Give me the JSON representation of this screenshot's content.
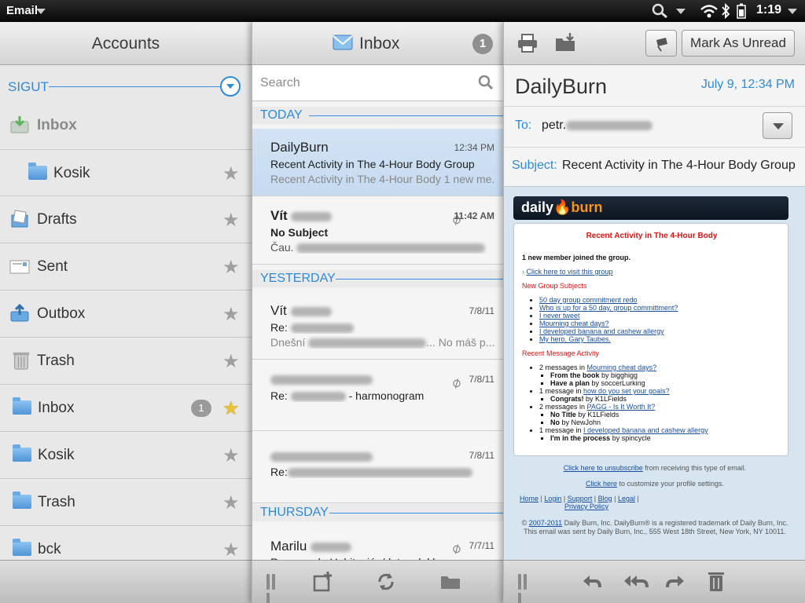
{
  "statusbar": {
    "app_name": "Email",
    "time": "1:19"
  },
  "accounts": {
    "title": "Accounts",
    "account_name": "SIGUT",
    "folders": [
      {
        "label": "Inbox",
        "icon": "inbox-icon",
        "muted": true
      },
      {
        "label": "Kosik",
        "icon": "folder-icon"
      },
      {
        "label": "Drafts",
        "icon": "drafts-icon"
      },
      {
        "label": "Sent",
        "icon": "sent-icon"
      },
      {
        "label": "Outbox",
        "icon": "outbox-icon"
      },
      {
        "label": "Trash",
        "icon": "trash-icon"
      },
      {
        "label": "Inbox",
        "icon": "folder-icon",
        "badge": "1",
        "favorite": true
      },
      {
        "label": "Kosik",
        "icon": "folder-icon"
      },
      {
        "label": "Trash",
        "icon": "folder-icon"
      },
      {
        "label": "bck",
        "icon": "folder-icon"
      }
    ]
  },
  "inbox": {
    "title": "Inbox",
    "unread_count": "1",
    "search_placeholder": "Search",
    "groups": {
      "today": "TODAY",
      "yesterday": "YESTERDAY",
      "thursday": "THURSDAY"
    },
    "messages": [
      {
        "from": "DailyBurn",
        "time": "12:34 PM",
        "subject": "Recent Activity in The 4-Hour Body Group",
        "preview": "Recent Activity in The 4-Hour Body 1 new me..."
      },
      {
        "from": "Vít",
        "time": "11:42 AM",
        "subject": "No Subject",
        "preview": "Čau."
      },
      {
        "from": "Vít",
        "time": "7/8/11",
        "subject": "Re:",
        "preview": "Dnešní",
        "preview_end": "... No máš p..."
      },
      {
        "from": "",
        "time": "7/8/11",
        "subject": "Re:",
        "subject_end": "- harmonogram",
        "preview": ""
      },
      {
        "from": "",
        "time": "7/8/11",
        "subject": "Re:",
        "preview": ""
      },
      {
        "from": "Marilu",
        "time": "7/7/11",
        "subject": "Reserva de Habitación/datos del h..."
      }
    ]
  },
  "message": {
    "mark_unread_label": "Mark As Unread",
    "sender": "DailyBurn",
    "date": "July 9, 12:34 PM",
    "to_label": "To:",
    "to_value": "petr.",
    "subject_label": "Subject:",
    "subject_value": "Recent Activity in The 4-Hour Body Group",
    "body": {
      "logo_a": "daily",
      "logo_b": "burn",
      "heading": "Recent Activity in The 4-Hour Body",
      "joined": "1 new member joined the group.",
      "visit_link": "Click here to visit this group",
      "new_subjects_title": "New Group Subjects",
      "new_subjects": [
        "50 day group commitment redo",
        "Who is up for a 50 day, group committment?",
        "I never tweet",
        "Mourning cheat days?",
        "I developed banana and cashew allergy",
        "My hero, Gary Taubes."
      ],
      "activity_title": "Recent Message Activity",
      "activity": [
        {
          "pre": "2 messages in",
          "link": "Mourning cheat days?",
          "items": [
            {
              "b": "From the book",
              "by": "by bigghigg"
            },
            {
              "b": "Have a plan",
              "by": "by soccerLurking"
            }
          ]
        },
        {
          "pre": "1 message in",
          "link": "how do you set your goals?",
          "items": [
            {
              "b": "Congrats!",
              "by": "by K1LFields"
            }
          ]
        },
        {
          "pre": "2 messages in",
          "link": "PAGG - Is It Worth It?",
          "items": [
            {
              "b": "No Title",
              "by": "by K1LFields"
            },
            {
              "b": "No",
              "by": "by NewJohn"
            }
          ]
        },
        {
          "pre": "1 message in",
          "link": "I developed banana and cashew allergy",
          "items": [
            {
              "b": "I'm in the process",
              "by": "by spincycle"
            }
          ]
        }
      ],
      "unsub_link": "Click here to unsubscribe",
      "unsub_rest": " from receiving this type of email.",
      "profile_link": "Click here",
      "profile_rest": " to customize your profile settings.",
      "footer_links": [
        "Home",
        "Login",
        "Support",
        "Blog",
        "Legal",
        "Privacy Policy"
      ],
      "copyright_link": "2007-2011",
      "copyright_pre": "©",
      "copyright_rest": " Daily Burn, Inc. DailyBurn® is a registered trademark of Daily Burn, Inc.",
      "address": "This email was sent by Daily Burn, Inc., 555 West 18th Street, New York, NY 10011."
    }
  },
  "colors": {
    "accent": "#2f8ad6",
    "selected_row": "#c9dcf1",
    "brand_orange": "#f7941d"
  }
}
